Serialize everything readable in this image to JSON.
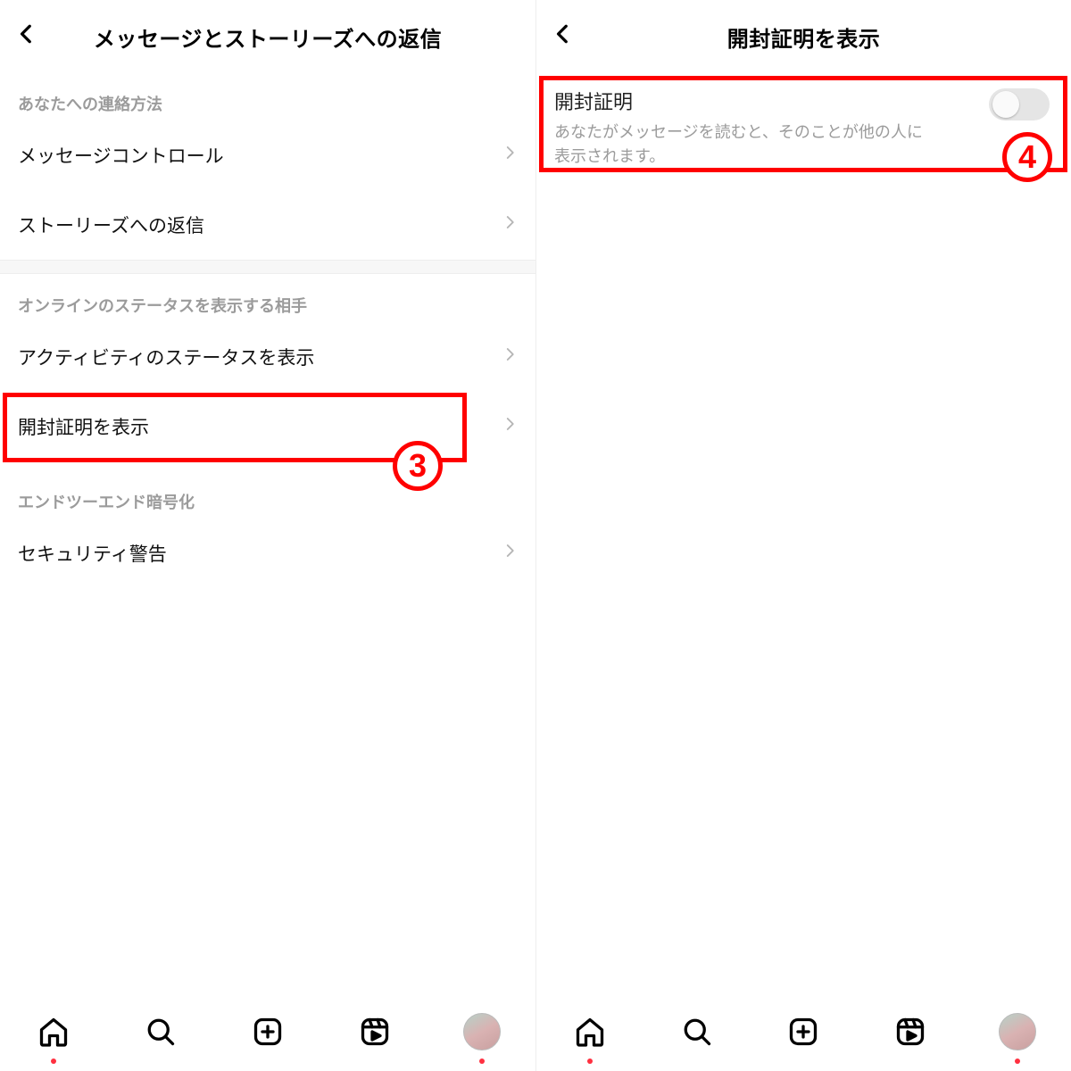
{
  "left": {
    "headerTitle": "メッセージとストーリーズへの返信",
    "sections": {
      "contact": {
        "head": "あなたへの連絡方法",
        "rows": {
          "messageControls": "メッセージコントロール",
          "storyReplies": "ストーリーズへの返信"
        }
      },
      "online": {
        "head": "オンラインのステータスを表示する相手",
        "rows": {
          "activityStatus": "アクティビティのステータスを表示",
          "readReceipts": "開封証明を表示"
        }
      },
      "e2e": {
        "head": "エンドツーエンド暗号化",
        "rows": {
          "securityAlerts": "セキュリティ警告"
        }
      }
    }
  },
  "right": {
    "headerTitle": "開封証明を表示",
    "toggle": {
      "title": "開封証明",
      "description": "あなたがメッセージを読むと、そのことが他の人に表示されます。"
    }
  },
  "annotations": {
    "step3": "3",
    "step4": "4"
  }
}
